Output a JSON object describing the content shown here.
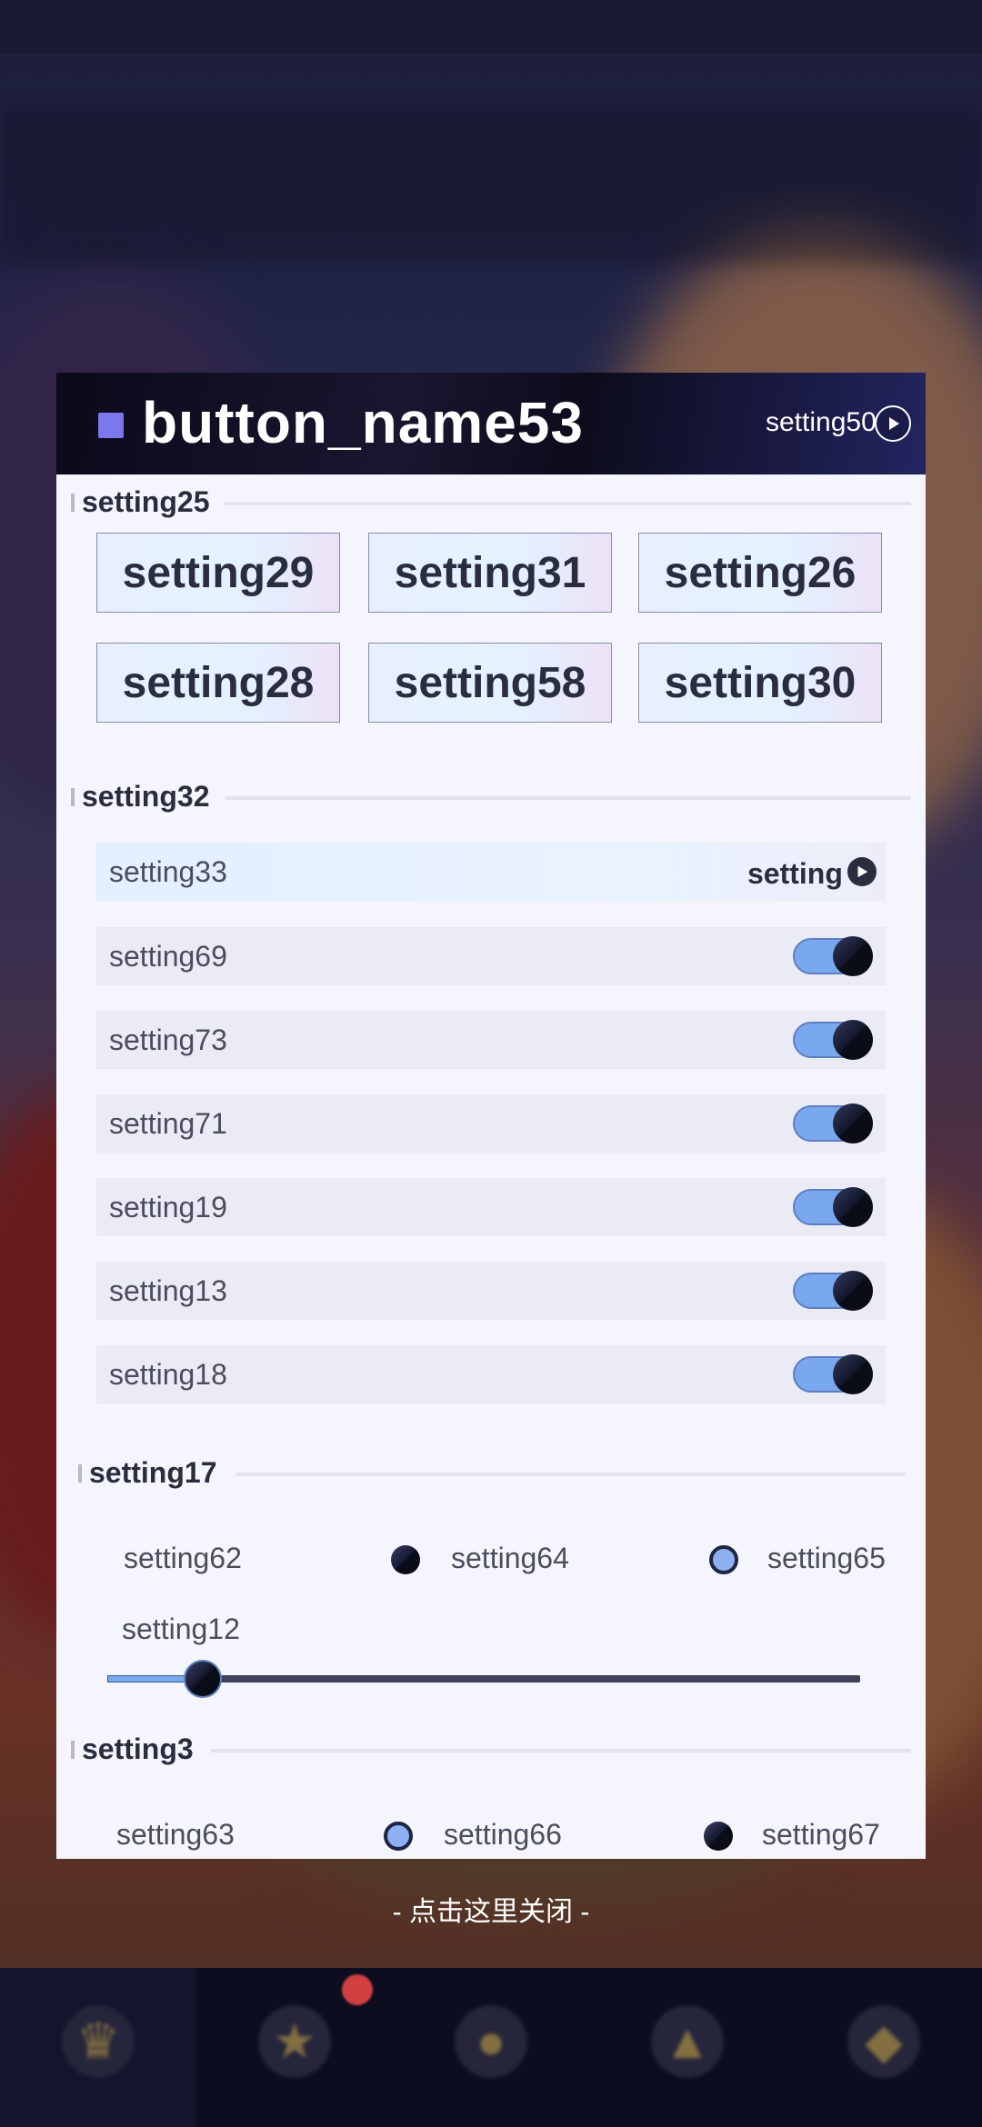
{
  "panel": {
    "title": "button_name53",
    "header_setting": "setting50",
    "close_hint": "- 点击这里关闭 -"
  },
  "section_buttons": {
    "title": "setting25",
    "buttons": [
      "setting29",
      "setting31",
      "setting26",
      "setting28",
      "setting58",
      "setting30"
    ]
  },
  "section_toggles": {
    "title": "setting32",
    "first_row": {
      "label": "setting33",
      "right_text": "setting"
    },
    "rows": [
      {
        "label": "setting69",
        "on": true
      },
      {
        "label": "setting73",
        "on": true
      },
      {
        "label": "setting71",
        "on": true
      },
      {
        "label": "setting19",
        "on": true
      },
      {
        "label": "setting13",
        "on": true
      },
      {
        "label": "setting18",
        "on": true
      }
    ]
  },
  "section_radio1": {
    "title": "setting17",
    "label": "setting62",
    "options": [
      {
        "label": "setting64",
        "selected": true
      },
      {
        "label": "setting65",
        "selected": false
      }
    ],
    "slider": {
      "label": "setting12",
      "value": 0.13
    }
  },
  "section_radio2": {
    "title": "setting3",
    "label": "setting63",
    "options": [
      {
        "label": "setting66",
        "selected": false
      },
      {
        "label": "setting67",
        "selected": true
      }
    ]
  },
  "colors": {
    "accent": "#7b78ee",
    "toggle_on": "#7aa8ee",
    "panel_bg": "#f4f5fd",
    "header_bg": "#0c0c1c"
  }
}
